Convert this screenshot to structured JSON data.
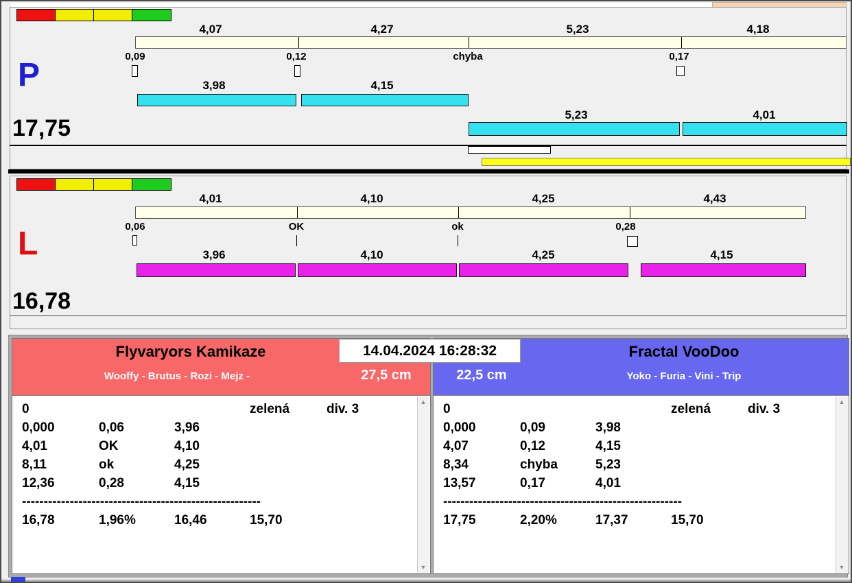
{
  "window": {
    "timestamp": "14.04.2024 16:28:32"
  },
  "icons": {
    "scroll_up": "▲",
    "scroll_down": "▼"
  },
  "colors": {
    "cyan_bar": "#35e1ef",
    "magenta_bar": "#e922e9",
    "cream_bar": "#ffffe8",
    "team_left_header": "#f86868",
    "team_right_header": "#6767ef",
    "light_red": "#ee1111",
    "light_yellow": "#f3ee00",
    "light_green": "#1ecc1e",
    "lane_p_label": "#1f1fd0",
    "lane_l_label": "#e01010",
    "yellow_bar": "#ffff19"
  },
  "lane_p": {
    "label": "P",
    "total": "17,75",
    "splits": [
      "4,07",
      "4,27",
      "5,23",
      "4,18"
    ],
    "marks": [
      "0,09",
      "0,12",
      "chyba",
      "0,17"
    ],
    "run_bars": [
      "3,98",
      "4,15",
      "5,23",
      "4,01"
    ]
  },
  "lane_l": {
    "label": "L",
    "total": "16,78",
    "splits": [
      "4,01",
      "4,10",
      "4,25",
      "4,43"
    ],
    "marks": [
      "0,06",
      "OK",
      "ok",
      "0,28"
    ],
    "run_bars": [
      "3,96",
      "4,10",
      "4,25",
      "4,15"
    ]
  },
  "teams": [
    {
      "name": "Flyvaryors Kamikaze",
      "dogs": "Wooffy - Brutus - Rozi - Mejz -",
      "jump_height": "27,5 cm",
      "rows": [
        [
          "0",
          "",
          "",
          "zelená",
          "div. 3"
        ],
        [
          "0,000",
          "0,06",
          "3,96",
          "",
          ""
        ],
        [
          "4,01",
          "OK",
          "4,10",
          "",
          ""
        ],
        [
          "8,11",
          "ok",
          "4,25",
          "",
          ""
        ],
        [
          "12,36",
          "0,28",
          "4,15",
          "",
          ""
        ],
        [
          "-------------------------------------------------------",
          "",
          "",
          "",
          ""
        ],
        [
          "16,78",
          "1,96%",
          "16,46",
          "15,70",
          ""
        ]
      ]
    },
    {
      "name": "Fractal VooDoo",
      "dogs": "Yoko - Furia - Vini - Trip",
      "jump_height": "22,5 cm",
      "rows": [
        [
          "0",
          "",
          "",
          "zelená",
          "div. 3"
        ],
        [
          "0,000",
          "0,09",
          "3,98",
          "",
          ""
        ],
        [
          "4,07",
          "0,12",
          "4,15",
          "",
          ""
        ],
        [
          "8,34",
          "chyba",
          "5,23",
          "",
          ""
        ],
        [
          "13,57",
          "0,17",
          "4,01",
          "",
          ""
        ],
        [
          "-------------------------------------------------------",
          "",
          "",
          "",
          ""
        ],
        [
          "17,75",
          "2,20%",
          "17,37",
          "15,70",
          ""
        ]
      ]
    }
  ]
}
